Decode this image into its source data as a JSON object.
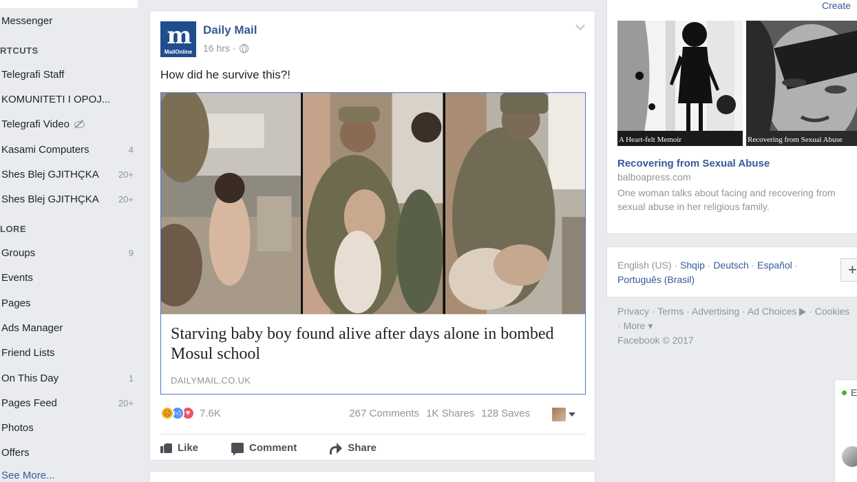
{
  "sidebar": {
    "top_item": "Messenger",
    "shortcuts_heading": "RTCUTS",
    "shortcuts": [
      {
        "label": "Telegrafi Staff",
        "count": ""
      },
      {
        "label": "KOMUNITETI I OPOJ...",
        "count": ""
      },
      {
        "label": "Telegrafi Video",
        "count": ""
      },
      {
        "label": "Kasami Computers",
        "count": "4"
      },
      {
        "label": "Shes Blej GJITHÇKA",
        "count": "20+"
      },
      {
        "label": "Shes Blej GJITHÇKA",
        "count": "20+"
      }
    ],
    "explore_heading": "LORE",
    "explore": [
      {
        "label": "Groups",
        "count": "9"
      },
      {
        "label": "Events",
        "count": ""
      },
      {
        "label": "Pages",
        "count": ""
      },
      {
        "label": "Ads Manager",
        "count": ""
      },
      {
        "label": "Friend Lists",
        "count": ""
      },
      {
        "label": "On This Day",
        "count": "1"
      },
      {
        "label": "Pages Feed",
        "count": "20+"
      },
      {
        "label": "Photos",
        "count": ""
      },
      {
        "label": "Offers",
        "count": ""
      }
    ],
    "see_more": "See More..."
  },
  "post": {
    "page_name": "Daily Mail",
    "logo_mark": "m",
    "logo_sub": "MailOnline",
    "time": "16 hrs · ",
    "text": "How did he survive this?!",
    "link_title": "Starving baby boy found alive after days alone in bombed Mosul school",
    "link_domain": "DAILYMAIL.CO.UK",
    "reaction_count": "7.6K",
    "comments": "267 Comments",
    "shares": "1K Shares",
    "saves": "128 Saves",
    "actions": {
      "like": "Like",
      "comment": "Comment",
      "share": "Share"
    }
  },
  "ad": {
    "create_label": "Create",
    "image_captions": [
      "A Heart-felt Memoir",
      "Recovering from Sexual Abuse"
    ],
    "title": "Recovering from Sexual Abuse",
    "domain": "balboapress.com",
    "description_line1": "One woman talks about facing and recovering from",
    "description_line2": "sexual abuse in her religious family."
  },
  "languages": {
    "current": "English (US)",
    "others": [
      "Shqip",
      "Deutsch",
      "Español",
      "Português (Brasil)"
    ],
    "add_label": "+"
  },
  "footer": {
    "links": [
      "Privacy",
      "Terms",
      "Advertising",
      "Ad Choices",
      "Cookies",
      "More"
    ],
    "copyright": "Facebook © 2017"
  },
  "chat": {
    "status_letter": "E"
  },
  "colors": {
    "link": "#365899",
    "muted": "#90949c",
    "background": "#e9ebee",
    "brand_logo": "#1e4e8c"
  },
  "icons": [
    "eye-slash-icon",
    "globe-icon",
    "chevron-down-icon",
    "thumbs-up-icon",
    "comment-icon",
    "share-icon",
    "ad-choices-icon"
  ]
}
